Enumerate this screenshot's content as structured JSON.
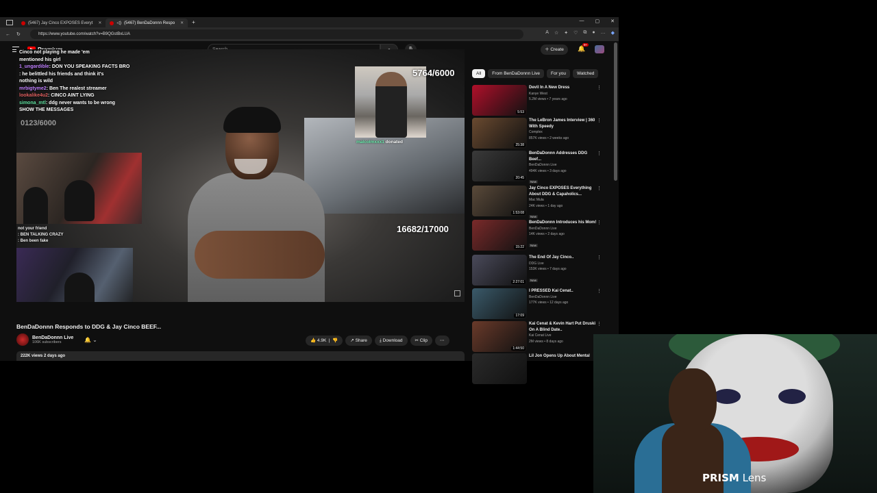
{
  "browser": {
    "tabs": [
      {
        "title": "(5467) Jay Cinco EXPOSES Everyt",
        "active": false
      },
      {
        "title": "(5467) BenDaDonnn Respo",
        "active": true
      }
    ],
    "new_tab": "+",
    "url": "https://www.youtube.com/watch?v=B9QGstBxLUA"
  },
  "header": {
    "brand": "Premium",
    "search_placeholder": "Search",
    "create_label": "Create",
    "notification_count": "9+"
  },
  "player": {
    "chat_lines": [
      {
        "user": "",
        "text": "Cinco not playing he made 'em"
      },
      {
        "user": "",
        "text": "mentioned his girl"
      },
      {
        "user": "1_ungardible",
        "text": ": DON YOU SPEAKING FACTS BRO"
      },
      {
        "user": "",
        "text": ": he belittled his friends and think it's"
      },
      {
        "user": "",
        "text": "nothing is wild"
      },
      {
        "user": "mrbigtyme2",
        "text": ": Ben The realest streamer"
      },
      {
        "user": "lookalike4u2",
        "text": ": CINCO AINT LYING"
      },
      {
        "user": "simona_mtl",
        "text": ": ddg never wants to be wrong"
      },
      {
        "user": "",
        "text": "SHOW THE MESSAGES"
      }
    ],
    "chat2_lines": [
      {
        "user": "",
        "text": "not your friend"
      },
      {
        "user": "",
        "text": ": BEN TALKING CRAZY"
      },
      {
        "user": "",
        "text": ": Ben been fake"
      }
    ],
    "goal_top": "5764/6000",
    "goal_bottom": "16682/17000",
    "goal_faint": "0123/6000",
    "donation_user": "malcolmxxx1",
    "donation_text": "donated"
  },
  "video": {
    "title": "BenDaDonnn Responds to DDG & Jay Cinco BEEF...",
    "channel": "BenDaDonnn Live",
    "subscribers": "106K subscribers",
    "likes": "4.9K",
    "share": "Share",
    "download": "Download",
    "clip": "Clip",
    "views_date": "222K views  2 days ago"
  },
  "chips": [
    "All",
    "From BenDaDonnn Live",
    "For you",
    "Watched"
  ],
  "recommendations": [
    {
      "title": "Devil In A New Dress",
      "channel": "Kanye West",
      "meta": "5.2M views • 7 years ago",
      "duration": "5:53",
      "new": false,
      "color": "#b0102a"
    },
    {
      "title": "The LeBron James Interview | 360 With Speedy",
      "channel": "Complex",
      "meta": "857K views • 2 weeks ago",
      "duration": "25:38",
      "new": false,
      "color": "#6a4a30"
    },
    {
      "title": "BenDaDonnn Addresses DDG Beef...",
      "channel": "BenDaDonnn Live",
      "meta": "494K views • 3 days ago",
      "duration": "20:45",
      "new": true,
      "color": "#3a3a3a"
    },
    {
      "title": "Jay Cinco EXPOSES Everything About DDG & Capaholics...",
      "channel": "Mac Mula",
      "meta": "24K views • 1 day ago",
      "duration": "1:53:08",
      "new": true,
      "color": "#5a4a3a"
    },
    {
      "title": "BenDaDonnn Introduces his Mom!",
      "channel": "BenDaDonnn Live",
      "meta": "14K views • 2 days ago",
      "duration": "15:22",
      "new": true,
      "color": "#7a2a2a"
    },
    {
      "title": "The End Of Jay Cinco..",
      "channel": "DDG Live",
      "meta": "153K views • 7 days ago",
      "duration": "2:27:01",
      "new": true,
      "color": "#4a4a5a"
    },
    {
      "title": "I PRESSED Kai Cenat..",
      "channel": "BenDaDonnn Live",
      "meta": "177K views • 12 days ago",
      "duration": "17:09",
      "new": false,
      "color": "#3a5a6a"
    },
    {
      "title": "Kai Cenat & Kevin Hart Put Druski On A Blind Date..",
      "channel": "Kai Cenat Live",
      "meta": "2M views • 8 days ago",
      "duration": "1:44:50",
      "new": false,
      "color": "#6a3a2a"
    },
    {
      "title": "Lil Jon Opens Up About Mental",
      "channel": "",
      "meta": "",
      "duration": "",
      "new": false,
      "color": "#2a2a2a"
    }
  ],
  "pip": {
    "brand_bold": "PRISM",
    "brand_light": " Lens"
  },
  "colors": {
    "accent": "#ff0000",
    "bg": "#0f0f0f"
  }
}
